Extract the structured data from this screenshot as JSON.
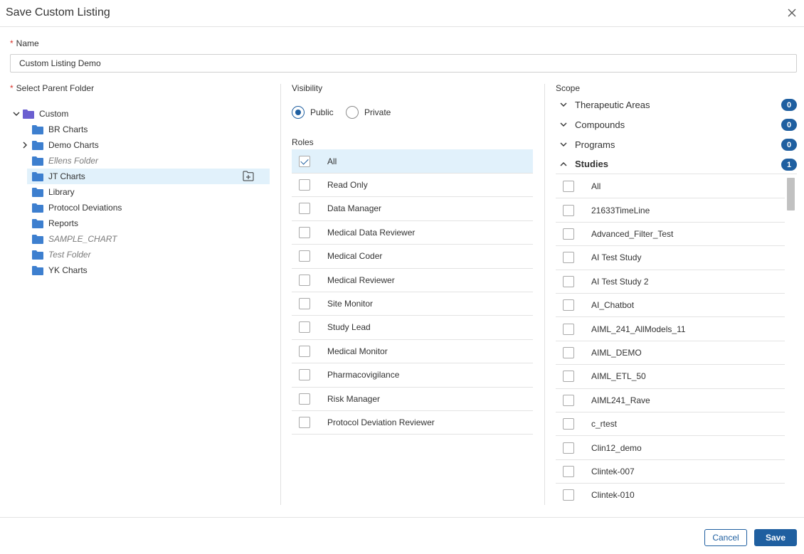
{
  "dialog": {
    "title": "Save Custom Listing"
  },
  "name_field": {
    "label": "Name",
    "value": "Custom Listing Demo"
  },
  "parent_folder": {
    "label": "Select Parent Folder",
    "root": {
      "label": "Custom",
      "expanded": true,
      "icon": "folder-icon-purple"
    },
    "children": [
      {
        "label": "BR Charts",
        "italic": false,
        "expandable": false
      },
      {
        "label": "Demo Charts",
        "italic": false,
        "expandable": true
      },
      {
        "label": "Ellens Folder",
        "italic": true,
        "expandable": false
      },
      {
        "label": "JT Charts",
        "italic": false,
        "expandable": false,
        "selected": true
      },
      {
        "label": "Library",
        "italic": false,
        "expandable": false
      },
      {
        "label": "Protocol Deviations",
        "italic": false,
        "expandable": false
      },
      {
        "label": "Reports",
        "italic": false,
        "expandable": false
      },
      {
        "label": "SAMPLE_CHART",
        "italic": true,
        "expandable": false
      },
      {
        "label": "Test Folder",
        "italic": true,
        "expandable": false
      },
      {
        "label": "YK Charts",
        "italic": false,
        "expandable": false
      }
    ]
  },
  "visibility": {
    "label": "Visibility",
    "options": [
      {
        "label": "Public",
        "selected": true
      },
      {
        "label": "Private",
        "selected": false
      }
    ]
  },
  "roles": {
    "label": "Roles",
    "items": [
      {
        "label": "All",
        "checked": true
      },
      {
        "label": "Read Only",
        "checked": false
      },
      {
        "label": "Data Manager",
        "checked": false
      },
      {
        "label": "Medical Data Reviewer",
        "checked": false
      },
      {
        "label": "Medical Coder",
        "checked": false
      },
      {
        "label": "Medical Reviewer",
        "checked": false
      },
      {
        "label": "Site Monitor",
        "checked": false
      },
      {
        "label": "Study Lead",
        "checked": false
      },
      {
        "label": "Medical Monitor",
        "checked": false
      },
      {
        "label": "Pharmacovigilance",
        "checked": false
      },
      {
        "label": "Risk Manager",
        "checked": false
      },
      {
        "label": "Protocol Deviation Reviewer",
        "checked": false
      }
    ]
  },
  "scope": {
    "label": "Scope",
    "sections": [
      {
        "label": "Therapeutic Areas",
        "count": "0",
        "expanded": false
      },
      {
        "label": "Compounds",
        "count": "0",
        "expanded": false
      },
      {
        "label": "Programs",
        "count": "0",
        "expanded": false
      },
      {
        "label": "Studies",
        "count": "1",
        "expanded": true
      }
    ],
    "studies": [
      "All",
      "21633TimeLine",
      "Advanced_Filter_Test",
      "AI Test Study",
      "AI Test Study 2",
      "AI_Chatbot",
      "AIML_241_AllModels_11",
      "AIML_DEMO",
      "AIML_ETL_50",
      "AIML241_Rave",
      "c_rtest",
      "Clin12_demo",
      "Clintek-007",
      "Clintek-010"
    ]
  },
  "footer": {
    "cancel_label": "Cancel",
    "save_label": "Save"
  },
  "colors": {
    "accent": "#1f5fa0",
    "folder_blue": "#3d7fcf",
    "folder_purple": "#6b5fd0",
    "selected_bg": "#e1f1fb",
    "required": "#d9342b"
  }
}
